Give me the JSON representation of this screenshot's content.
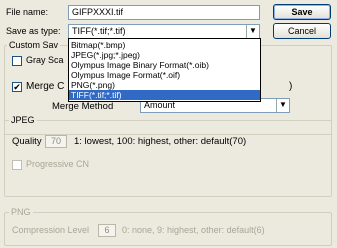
{
  "file_name": {
    "label": "File name:",
    "value": "GIFPXXXI.tif"
  },
  "save_as_type": {
    "label": "Save as type:",
    "value": "TIFF(*.tif;*.tif)",
    "options": [
      "Bitmap(*.bmp)",
      "JPEG(*.jpg;*.jpeg)",
      "Olympus Image Binary Format(*.oib)",
      "Olympus Image Format(*.oif)",
      "PNG(*.png)",
      "TIFF(*.tif;*.tif)"
    ]
  },
  "buttons": {
    "save": "Save",
    "cancel": "Cancel"
  },
  "custom": {
    "group_label": "Custom Sav",
    "gray_scale_label": "Gray Sca",
    "merge_label": "Merge C",
    "merge_tail": ")",
    "merge_method_label": "Merge Method",
    "merge_method_value": "Amount"
  },
  "jpeg": {
    "group_label": "JPEG",
    "quality_label": "Quality",
    "quality_value": "70",
    "quality_hint": "1: lowest, 100: highest, other: default(70)",
    "progressive_label": "Progressive CN"
  },
  "png": {
    "group_label": "PNG",
    "compression_label": "Compression Level",
    "compression_value": "6",
    "compression_hint": "0: none, 9: highest, other: default(6)"
  },
  "icons": {
    "dropdown_arrow": "▼",
    "checkmark": "✔"
  }
}
